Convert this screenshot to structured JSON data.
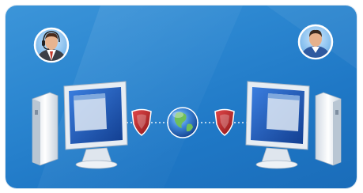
{
  "diagram": {
    "nodes": [
      {
        "id": "support-agent",
        "kind": "person-with-headset",
        "icon": "support-agent-avatar-icon"
      },
      {
        "id": "customer",
        "kind": "person",
        "icon": "customer-avatar-icon"
      },
      {
        "id": "left-computer",
        "kind": "desktop-computer",
        "icon": "desktop-computer-icon"
      },
      {
        "id": "left-shield",
        "kind": "security-shield",
        "icon": "shield-icon"
      },
      {
        "id": "internet",
        "kind": "globe",
        "icon": "globe-icon"
      },
      {
        "id": "right-shield",
        "kind": "security-shield",
        "icon": "shield-icon"
      },
      {
        "id": "right-computer",
        "kind": "desktop-computer",
        "icon": "desktop-computer-icon"
      }
    ],
    "connections": [
      {
        "from": "left-computer",
        "to": "left-shield",
        "style": "dotted"
      },
      {
        "from": "left-shield",
        "to": "internet",
        "style": "dotted"
      },
      {
        "from": "internet",
        "to": "right-shield",
        "style": "dotted"
      },
      {
        "from": "right-shield",
        "to": "right-computer",
        "style": "dotted"
      }
    ],
    "colors": {
      "background": "#2b86d0",
      "shield": "#c8272a",
      "globe": "#2f6fc4",
      "avatar_ring": "#ffffff",
      "agent_shirt": "#c43a2c",
      "computer_body": "#e9eef3",
      "screen": "#1e5cb8"
    }
  }
}
